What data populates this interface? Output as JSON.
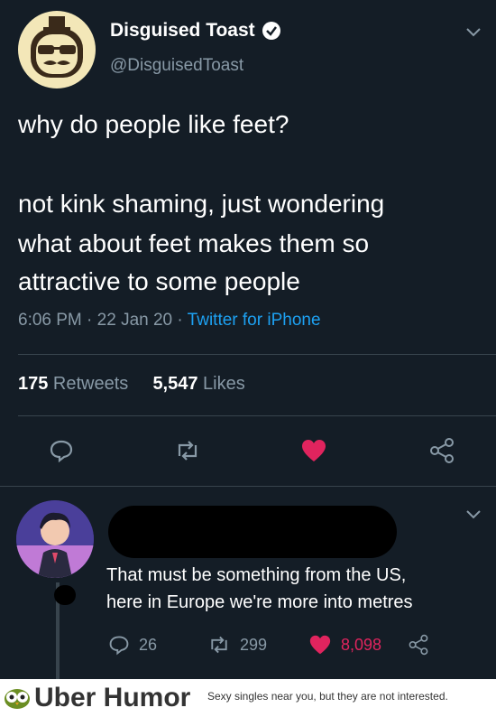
{
  "author": {
    "name": "Disguised Toast",
    "handle": "@DisguisedToast"
  },
  "tweet": {
    "line1": "why do people like feet?",
    "line2": "not kink shaming, just wondering",
    "line3": "what about feet makes them so",
    "line4": "attractive to some people",
    "time": "6:06 PM",
    "sep1": " · ",
    "date": "22 Jan 20",
    "sep2": " · ",
    "source": "Twitter for iPhone"
  },
  "stats": {
    "retweets_count": "175",
    "retweets_label": " Retweets",
    "likes_count": "5,547",
    "likes_label": " Likes"
  },
  "reply": {
    "line1": "That must be something from the US,",
    "line2": "here in Europe we're more into metres",
    "replies": "26",
    "retweets": "299",
    "likes": "8,098"
  },
  "footer": {
    "brand": "Uber Humor",
    "tagline": "Sexy singles near you, but they are not interested."
  },
  "colors": {
    "background": "#141d26",
    "like": "#e0245e",
    "link": "#1da1f2",
    "muted": "#8899a6"
  }
}
